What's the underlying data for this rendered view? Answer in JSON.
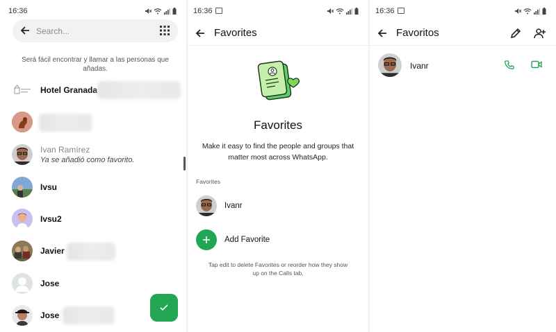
{
  "status_bar": {
    "time": "16:36"
  },
  "screen1": {
    "search_placeholder": "Search...",
    "hint": "Será fácil encontrar y llamar a las personas que añadas.",
    "contacts": [
      {
        "name": "Hotel Granada",
        "avatar": "hotel-logo"
      },
      {
        "name": "",
        "avatar": "squirrel"
      },
      {
        "name": "Ivan Ramírez",
        "subtitle": "Ya se añadió como favorito.",
        "avatar": "man-glasses"
      },
      {
        "name": "Ivsu",
        "avatar": "landscape"
      },
      {
        "name": "Ivsu2",
        "avatar": "cartoon-man"
      },
      {
        "name": "Javier",
        "avatar": "group-photo"
      },
      {
        "name": "Jose",
        "avatar": "default-person"
      },
      {
        "name": "Jose",
        "avatar": "man-cap"
      }
    ]
  },
  "screen2": {
    "title": "Favorites",
    "heading": "Favorites",
    "description": "Make it easy to find the people and groups that matter most across WhatsApp.",
    "section_label": "Favorites",
    "favorite_name": "Ivanr",
    "add_label": "Add Favorite",
    "footer": "Tap edit to delete Favorites or reorder how they show up on the Calls tab."
  },
  "screen3": {
    "title": "Favoritos",
    "contact_name": "Ivanr"
  },
  "colors": {
    "accent": "#22a653",
    "illustration_light": "#b9eba0",
    "illustration_dark": "#5fcf6a"
  }
}
